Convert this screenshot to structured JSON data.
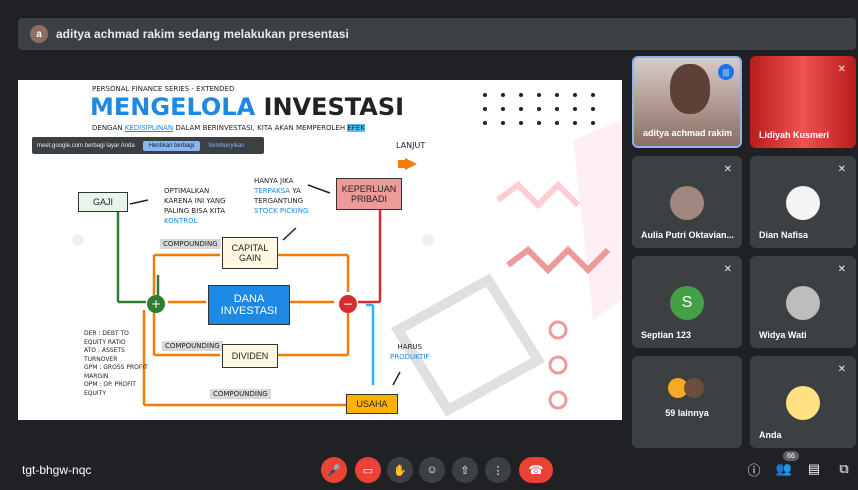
{
  "presenter_bar": {
    "avatar_letter": "a",
    "text": "aditya achmad rakim sedang melakukan presentasi"
  },
  "slide": {
    "series": "PERSONAL FINANCE SERIES - EXTENDED",
    "title_a": "MENGELOLA",
    "title_b": "INVESTASI",
    "subtitle_pre": "DENGAN",
    "subtitle_hl": "KEDISIPLINAN",
    "subtitle_mid": "DALAM BERINVESTASI, KITA AKAN MEMPEROLEH",
    "subtitle_end": "EFEK",
    "share_banner": {
      "text": "meet.google.com berbagi layar Anda",
      "stop": "Hentikan berbagi",
      "hide": "Sembunyikan"
    },
    "lanjut": "LANJUT",
    "gaji": "GAJI",
    "optimalkan": [
      "OPTIMALKAN",
      "KARENA INI YANG",
      "PALING BISA KITA",
      "KONTROL"
    ],
    "hanya_jika": [
      "HANYA JIKA",
      "TERPAKSA",
      "YA",
      "TERGANTUNG",
      "STOCK PICKING"
    ],
    "keperluan": [
      "KEPERLUAN",
      "PRIBADI"
    ],
    "compounding": "COMPOUNDING",
    "capital_gain": [
      "CAPITAL",
      "GAIN"
    ],
    "dana": [
      "DANA",
      "INVESTASI"
    ],
    "dividen": "DIVIDEN",
    "harus": [
      "HARUS",
      "PRODUKTIF"
    ],
    "usaha": "USAHA",
    "ratios": [
      "DER : DEBT TO",
      "EQUITY RATIO",
      "ATO : ASSETS",
      "TURNOVER",
      "GPM : GROSS PROFIT",
      "MARGIN",
      "OPM : OP. PROFIT",
      "EQUITY"
    ]
  },
  "participants": [
    {
      "name": "aditya achmad rakim",
      "speaking": true
    },
    {
      "name": "Lidiyah Kusmeri"
    },
    {
      "name": "Aulia Putri Oktavian..."
    },
    {
      "name": "Dian Nafisa"
    },
    {
      "name": "Septian 123",
      "initial": "S"
    },
    {
      "name": "Widya Wati"
    },
    {
      "name": "59 lainnya"
    },
    {
      "name": "Anda"
    }
  ],
  "bottom": {
    "meeting_code": "tgt-bhgw-nqc",
    "people_count": "66"
  }
}
